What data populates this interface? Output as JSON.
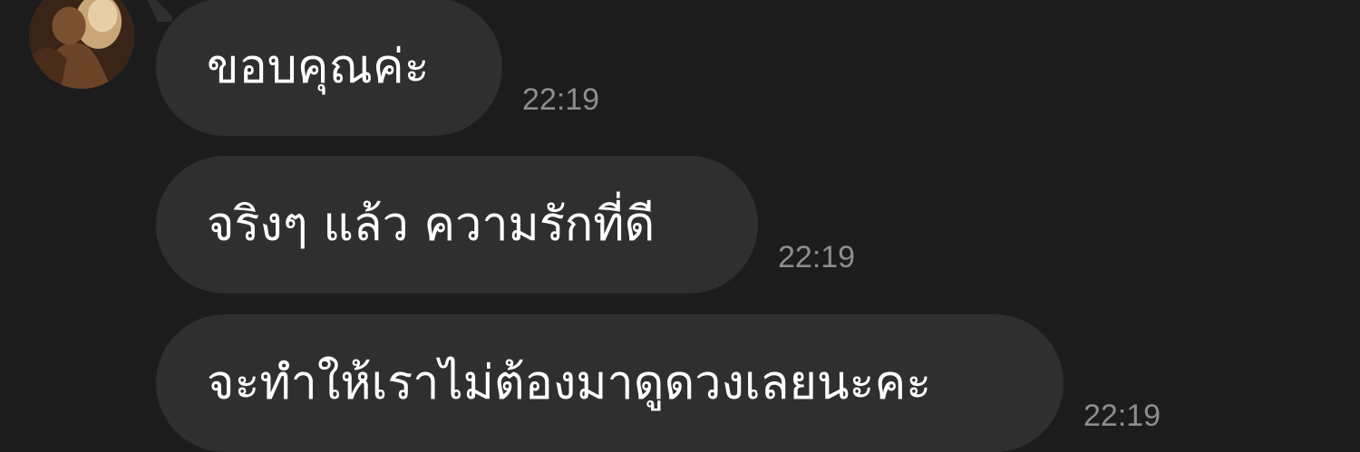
{
  "messages": [
    {
      "text": "ขอบคุณค่ะ",
      "time": "22:19"
    },
    {
      "text": "จริงๆ แล้ว ความรักที่ดี",
      "time": "22:19"
    },
    {
      "text": "จะทำให้เราไม่ต้องมาดูดวงเลยนะคะ",
      "time": "22:19"
    }
  ],
  "colors": {
    "background": "#1c1c1c",
    "bubble": "#2f2f2f",
    "message_text": "#ffffff",
    "timestamp": "#8d8d8d"
  },
  "icons": {
    "avatar": "sender-avatar"
  }
}
